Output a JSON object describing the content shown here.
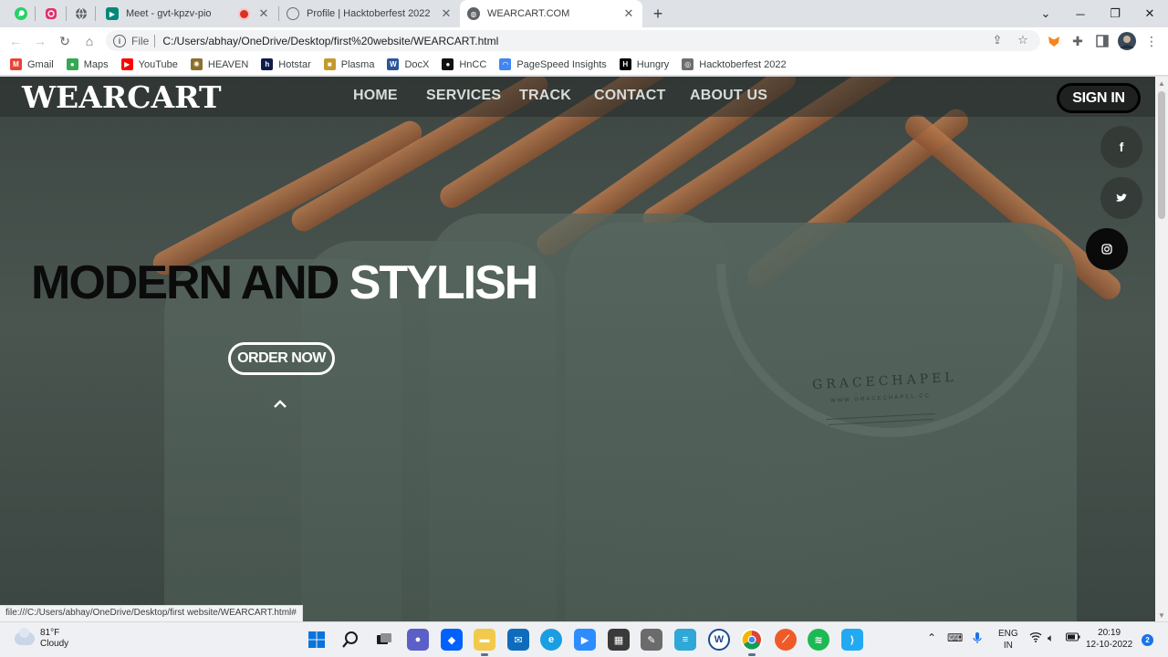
{
  "browser": {
    "pinned_tabs": [
      {
        "icon": "whatsapp-icon",
        "color": "#25d366"
      },
      {
        "icon": "instagram-icon",
        "color": "#e1306c"
      },
      {
        "icon": "globe-icon",
        "color": "#5f6368"
      }
    ],
    "tabs": [
      {
        "title": "Meet - gvt-kpzv-pio",
        "icon": "google-meet-icon",
        "color": "#00897b"
      },
      {
        "title": "Profile | Hacktoberfest 2022",
        "icon": "hacktoberfest-icon",
        "color": "#6e6e6e"
      },
      {
        "title": "WEARCART.COM",
        "icon": "globe-icon",
        "color": "#5f6368"
      }
    ],
    "new_tab_label": "+",
    "address": {
      "scheme": "File",
      "url": "C:/Users/abhay/OneDrive/Desktop/first%20website/WEARCART.html"
    },
    "bookmarks": [
      {
        "label": "Gmail",
        "icon": "gmail-icon",
        "color": "#ea4335",
        "glyph": "M"
      },
      {
        "label": "Maps",
        "icon": "maps-icon",
        "color": "#34a853",
        "glyph": "●"
      },
      {
        "label": "YouTube",
        "icon": "youtube-icon",
        "color": "#ff0000",
        "glyph": "▶"
      },
      {
        "label": "HEAVEN",
        "icon": "heaven-icon",
        "color": "#8d6e2c",
        "glyph": "✺"
      },
      {
        "label": "Hotstar",
        "icon": "hotstar-icon",
        "color": "#0c1c4c",
        "glyph": "h"
      },
      {
        "label": "Plasma",
        "icon": "plasma-icon",
        "color": "#c59a2a",
        "glyph": "■"
      },
      {
        "label": "DocX",
        "icon": "word-icon",
        "color": "#2b579a",
        "glyph": "W"
      },
      {
        "label": "HnCC",
        "icon": "hncc-icon",
        "color": "#111111",
        "glyph": "●"
      },
      {
        "label": "PageSpeed Insights",
        "icon": "pagespeed-icon",
        "color": "#4285f4",
        "glyph": "◠"
      },
      {
        "label": "Hungry",
        "icon": "hungry-icon",
        "color": "#000000",
        "glyph": "H"
      },
      {
        "label": "Hacktoberfest 2022",
        "icon": "hacktoberfest-icon",
        "color": "#6e6e6e",
        "glyph": "◎"
      }
    ],
    "status_url": "file:///C:/Users/abhay/OneDrive/Desktop/first website/WEARCART.html#"
  },
  "site": {
    "logo": "WEARCART",
    "nav": [
      "HOME",
      "SERVICES",
      "TRACK",
      "CONTACT",
      "ABOUT US"
    ],
    "signin": "SIGN IN",
    "social": [
      "f",
      "t",
      "ig"
    ],
    "hero": {
      "title_dark": "MODERN AND",
      "title_light": "STYLISH",
      "cta": "ORDER NOW"
    },
    "photo_label": {
      "brand": "GRACECHAPEL",
      "sub": "WWW.GRACECHAPEL.CC"
    }
  },
  "taskbar": {
    "weather": {
      "temp": "81°F",
      "condition": "Cloudy"
    },
    "lang": {
      "line1": "ENG",
      "line2": "IN"
    },
    "clock": {
      "time": "20:19",
      "date": "12-10-2022"
    },
    "notifications": "2"
  }
}
